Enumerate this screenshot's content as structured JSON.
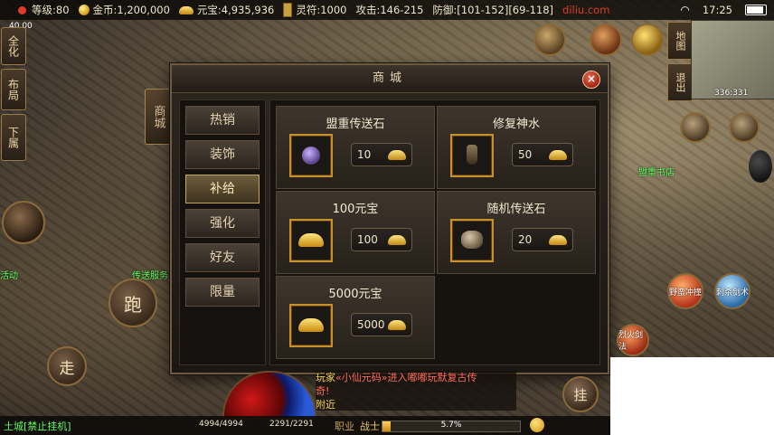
{
  "status": {
    "level": "等级:80",
    "gold": "金币:1,200,000",
    "yuanbao": "元宝:4,935,936",
    "lingfu": "灵符:1000",
    "attack": "攻击:146-215",
    "defense": "防御:[101-152][69-118]",
    "watermark": "diliu.com",
    "time": "17:25"
  },
  "left_buttons": [
    "全化",
    "布局",
    "下属"
  ],
  "fps_label": "40.00",
  "side_tab": "商城",
  "shop": {
    "title": "商城",
    "close_label": "×",
    "tabs": [
      {
        "label": "热销",
        "active": false
      },
      {
        "label": "装饰",
        "active": false
      },
      {
        "label": "补给",
        "active": true
      },
      {
        "label": "强化",
        "active": false
      },
      {
        "label": "好友",
        "active": false
      },
      {
        "label": "限量",
        "active": false
      }
    ],
    "items": [
      {
        "name": "盟重传送石",
        "price": "10",
        "icon": "teleport-stone-gem-icon"
      },
      {
        "name": "修复神水",
        "price": "50",
        "icon": "repair-potion-icon"
      },
      {
        "name": "100元宝",
        "price": "100",
        "icon": "gold-ingot-icon"
      },
      {
        "name": "随机传送石",
        "price": "20",
        "icon": "random-teleport-stone-icon"
      },
      {
        "name": "5000元宝",
        "price": "5000",
        "icon": "gold-ingot-icon"
      }
    ]
  },
  "minimap": {
    "map_label": "地图",
    "exit_label": "退出",
    "coords": "336:331"
  },
  "actions": {
    "run": "跑",
    "walk": "走",
    "hang": "挂"
  },
  "skills": [
    "野蛮冲撞",
    "刺杀剑术",
    "烈火剑法"
  ],
  "npc_labels": [
    "盟重书店",
    "活动",
    "传送服务"
  ],
  "chat": {
    "line1_prefix": "玩家",
    "line1_name": "«小仙元码»",
    "line1_text": "进入嘟嘟玩默复古传",
    "line2": "奇!",
    "line3": "附近"
  },
  "bottom": {
    "location": "土城[禁止挂机]",
    "hp": "4994/4994",
    "mp": "2291/2291",
    "job_label": "职业",
    "job_value": "战士",
    "exp_percent": "5.7%",
    "exp_fraction": 0.057
  },
  "colors": {
    "tab_active_border": "#c9a45a",
    "item_icon_border": "#c8902c",
    "npc_green": "#5dff5d",
    "close_red": "#a12414"
  }
}
